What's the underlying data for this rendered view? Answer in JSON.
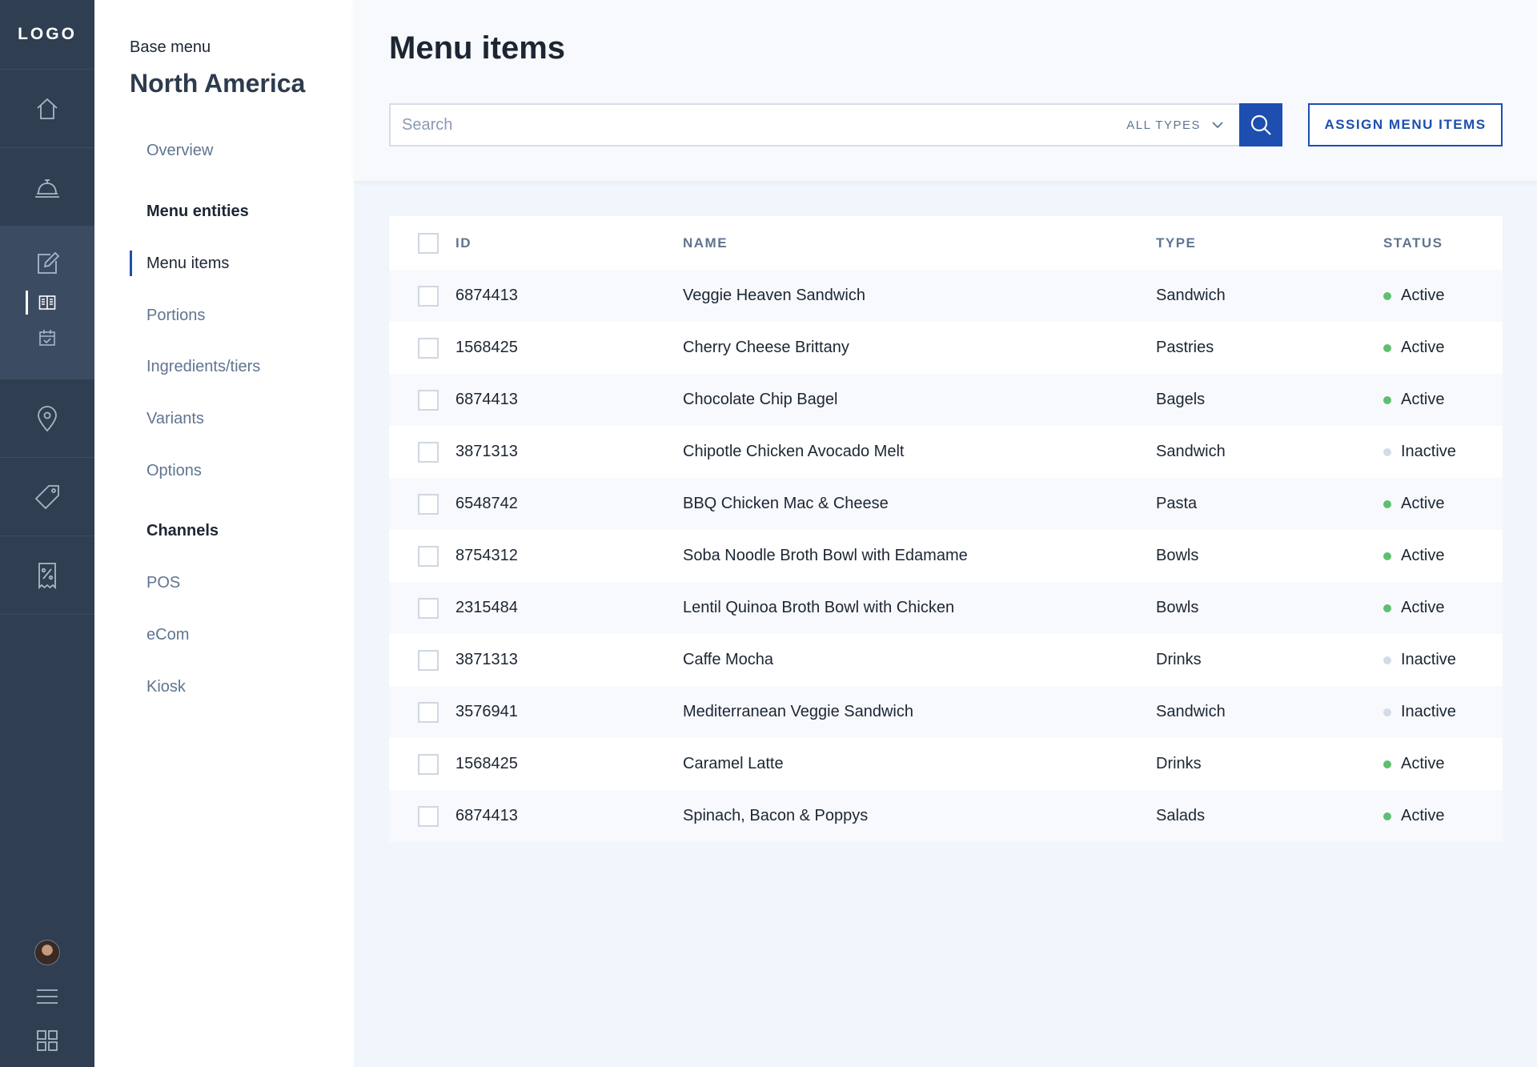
{
  "rail": {
    "logo": "LOGO",
    "items": [
      {
        "icon": "home-icon"
      },
      {
        "icon": "service-bell-icon"
      },
      {
        "icon": "edit-icon",
        "sub": [
          "menu-book-icon",
          "calendar-check-icon"
        ]
      },
      {
        "icon": "location-pin-icon"
      },
      {
        "icon": "tag-icon"
      },
      {
        "icon": "receipt-percent-icon"
      }
    ],
    "bottom": [
      "avatar",
      "hamburger-menu-icon",
      "grid-apps-icon"
    ]
  },
  "subnav": {
    "crumb": "Base menu",
    "region": "North America",
    "overview": "Overview",
    "section_entities": "Menu entities",
    "menu_items": "Menu items",
    "portions": "Portions",
    "ingredients": "Ingredients/tiers",
    "variants": "Variants",
    "options": "Options",
    "section_channels": "Channels",
    "pos": "POS",
    "ecom": "eCom",
    "kiosk": "Kiosk"
  },
  "header": {
    "title": "Menu items",
    "search_placeholder": "Search",
    "type_filter": "ALL TYPES",
    "assign_label": "ASSIGN MENU ITEMS"
  },
  "table": {
    "columns": {
      "id": "ID",
      "name": "NAME",
      "type": "TYPE",
      "status": "STATUS"
    },
    "rows": [
      {
        "id": "6874413",
        "name": "Veggie Heaven Sandwich",
        "type": "Sandwich",
        "status": "Active"
      },
      {
        "id": "1568425",
        "name": "Cherry Cheese Brittany",
        "type": "Pastries",
        "status": "Active"
      },
      {
        "id": "6874413",
        "name": "Chocolate Chip Bagel",
        "type": "Bagels",
        "status": "Active"
      },
      {
        "id": "3871313",
        "name": "Chipotle Chicken Avocado Melt",
        "type": "Sandwich",
        "status": "Inactive"
      },
      {
        "id": "6548742",
        "name": "BBQ Chicken Mac & Cheese",
        "type": "Pasta",
        "status": "Active"
      },
      {
        "id": "8754312",
        "name": "Soba Noodle Broth Bowl with Edamame",
        "type": "Bowls",
        "status": "Active"
      },
      {
        "id": "2315484",
        "name": "Lentil Quinoa Broth Bowl with Chicken",
        "type": "Bowls",
        "status": "Active"
      },
      {
        "id": "3871313",
        "name": "Caffe Mocha",
        "type": "Drinks",
        "status": "Inactive"
      },
      {
        "id": "3576941",
        "name": "Mediterranean Veggie Sandwich",
        "type": "Sandwich",
        "status": "Inactive"
      },
      {
        "id": "1568425",
        "name": "Caramel Latte",
        "type": "Drinks",
        "status": "Active"
      },
      {
        "id": "6874413",
        "name": "Spinach, Bacon & Poppys",
        "type": "Salads",
        "status": "Active"
      }
    ]
  },
  "colors": {
    "rail": "#2f3e51",
    "accent": "#1d4eb0",
    "active_dot": "#5fbf6f",
    "inactive_dot": "#d3dbe6"
  }
}
